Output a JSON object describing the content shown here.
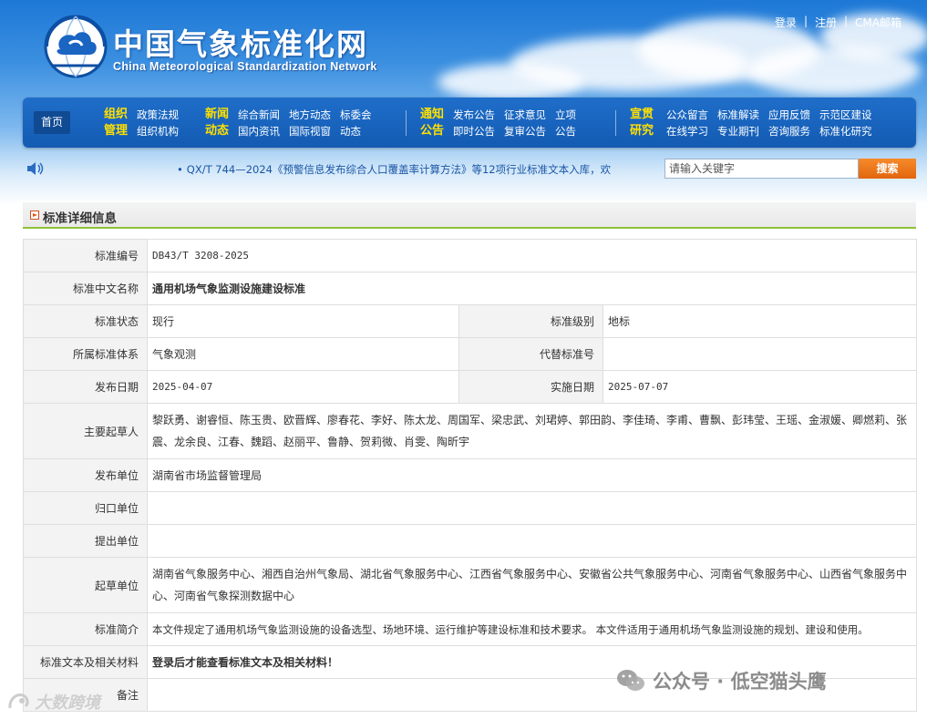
{
  "site": {
    "title_cn": "中国气象标准化网",
    "title_en": "China Meteorological Standardization Network"
  },
  "top_links": {
    "login": "登录",
    "register": "注册",
    "mail": "CMA邮箱",
    "separator": "|"
  },
  "nav": {
    "home": "首页",
    "groups": [
      {
        "cat_line1": "组织",
        "cat_line2": "管理",
        "row1": [
          "政策法规"
        ],
        "row2": [
          "组织机构"
        ]
      },
      {
        "cat_line1": "新闻",
        "cat_line2": "动态",
        "row1": [
          "综合新闻",
          "地方动态",
          "标委会"
        ],
        "row2": [
          "国内资讯",
          "国际视窗",
          "动态"
        ]
      },
      {
        "cat_line1": "通知",
        "cat_line2": "公告",
        "row1": [
          "发布公告",
          "征求意见",
          "立项"
        ],
        "row2": [
          "即时公告",
          "复审公告",
          "公告"
        ]
      },
      {
        "cat_line1": "宣贯",
        "cat_line2": "研究",
        "row1": [
          "公众留言",
          "标准解读",
          "应用反馈",
          "示范区建设"
        ],
        "row2": [
          "在线学习",
          "专业期刊",
          "咨询服务",
          "标准化研究"
        ]
      }
    ]
  },
  "notice": {
    "bullet": "•",
    "text": "QX/T 744—2024《预警信息发布综合人口覆盖率计算方法》等12项行业标准文本入库，欢"
  },
  "search": {
    "placeholder": "请输入关键字",
    "button": "搜索"
  },
  "section": {
    "title": "标准详细信息"
  },
  "detail": {
    "std_no_label": "标准编号",
    "std_no": "DB43/T 3208-2025",
    "cn_name_label": "标准中文名称",
    "cn_name": "通用机场气象监测设施建设标准",
    "status_label": "标准状态",
    "status": "现行",
    "level_label": "标准级别",
    "level": "地标",
    "system_label": "所属标准体系",
    "system": "气象观测",
    "replace_label": "代替标准号",
    "replace": "",
    "publish_date_label": "发布日期",
    "publish_date": "2025-04-07",
    "impl_date_label": "实施日期",
    "impl_date": "2025-07-07",
    "drafters_label": "主要起草人",
    "drafters": "黎跃勇、谢睿恒、陈玉贵、欧晋辉、廖春花、李好、陈太龙、周国军、梁忠武、刘珺婷、郭田韵、李佳琦、李甫、曹飘、彭玮莹、王瑶、金淑媛、卿燃莉、张震、龙余良、江春、魏蹈、赵丽平、鲁静、贺莉微、肖雯、陶昕宇",
    "publisher_label": "发布单位",
    "publisher": "湖南省市场监督管理局",
    "owner_label": "归口单位",
    "owner": "",
    "proposer_label": "提出单位",
    "proposer": "",
    "drafting_units_label": "起草单位",
    "drafting_units": "湖南省气象服务中心、湘西自治州气象局、湖北省气象服务中心、江西省气象服务中心、安徽省公共气象服务中心、河南省气象服务中心、山西省气象服务中心、河南省气象探测数据中心",
    "summary_label": "标准简介",
    "summary": "本文件规定了通用机场气象监测设施的设备选型、场地环境、运行维护等建设标准和技术要求。 本文件适用于通用机场气象监测设施的规划、建设和使用。",
    "materials_label": "标准文本及相关材料",
    "materials": "登录后才能查看标准文本及相关材料！",
    "remarks_label": "备注",
    "remarks": ""
  },
  "watermarks": {
    "wechat": "公众号 · 低空猫头鹰",
    "brand": "大数跨境"
  },
  "colors": {
    "nav_bg": "#1663be",
    "nav_category": "#ffe000",
    "search_button": "#ee7419",
    "section_underline": "#8fc23b",
    "login_notice": "#e0001b"
  }
}
